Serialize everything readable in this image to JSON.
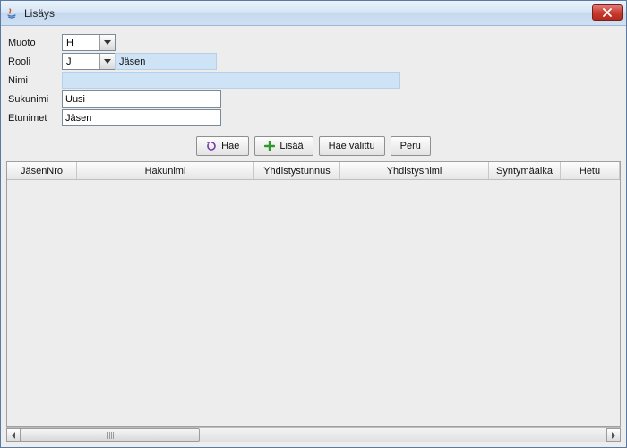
{
  "window": {
    "title": "Lisäys"
  },
  "form": {
    "muoto": {
      "label": "Muoto",
      "value": "H"
    },
    "rooli": {
      "label": "Rooli",
      "value": "J",
      "display": "Jäsen"
    },
    "nimi": {
      "label": "Nimi",
      "value": ""
    },
    "sukunimi": {
      "label": "Sukunimi",
      "value": "Uusi"
    },
    "etunimet": {
      "label": "Etunimet",
      "value": "Jäsen"
    }
  },
  "buttons": {
    "hae": "Hae",
    "lisaa": "Lisää",
    "hae_valittu": "Hae valittu",
    "peru": "Peru"
  },
  "table": {
    "columns": [
      "JäsenNro",
      "Hakunimi",
      "Yhdistystunnus",
      "Yhdistysnimi",
      "Syntymäaika",
      "Hetu"
    ]
  }
}
